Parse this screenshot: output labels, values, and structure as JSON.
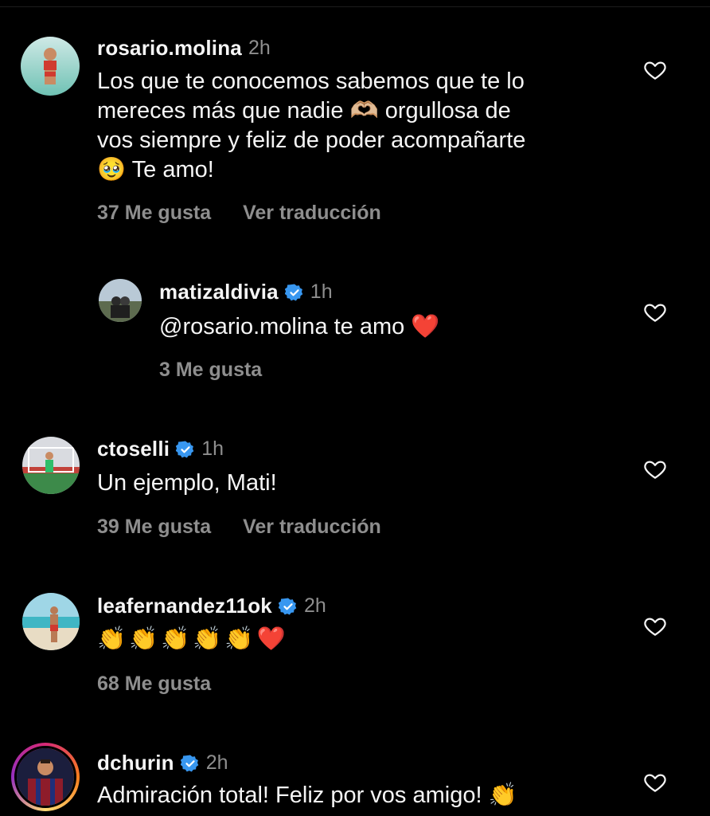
{
  "comments": [
    {
      "username": "rosario.molina",
      "verified": false,
      "time": "2h",
      "text": "Los que te conocemos sabemos que te lo\nmereces más que nadie 🫶🏼 orgullosa de\nvos siempre y feliz de poder acompañarte\n🥹 Te amo!",
      "likes": "37 Me gusta",
      "translate": "Ver traducción"
    },
    {
      "username": "matizaldivia",
      "verified": true,
      "time": "1h",
      "text": "@rosario.molina te amo ❤️",
      "likes": "3 Me gusta"
    },
    {
      "username": "ctoselli",
      "verified": true,
      "time": "1h",
      "text": "Un ejemplo, Mati!",
      "likes": "39 Me gusta",
      "translate": "Ver traducción"
    },
    {
      "username": "leafernandez11ok",
      "verified": true,
      "time": "2h",
      "text": "👏👏👏👏👏❤️",
      "likes": "68 Me gusta"
    },
    {
      "username": "dchurin",
      "verified": true,
      "time": "2h",
      "text": "Admiración total! Feliz por vos amigo! 👏"
    }
  ],
  "colors": {
    "background": "#000000",
    "text": "#f5f5f5",
    "muted": "#8e8e8e",
    "verified": "#3897f0"
  },
  "icons": {
    "like": "heart-outline-icon",
    "verified": "verified-badge-icon"
  }
}
